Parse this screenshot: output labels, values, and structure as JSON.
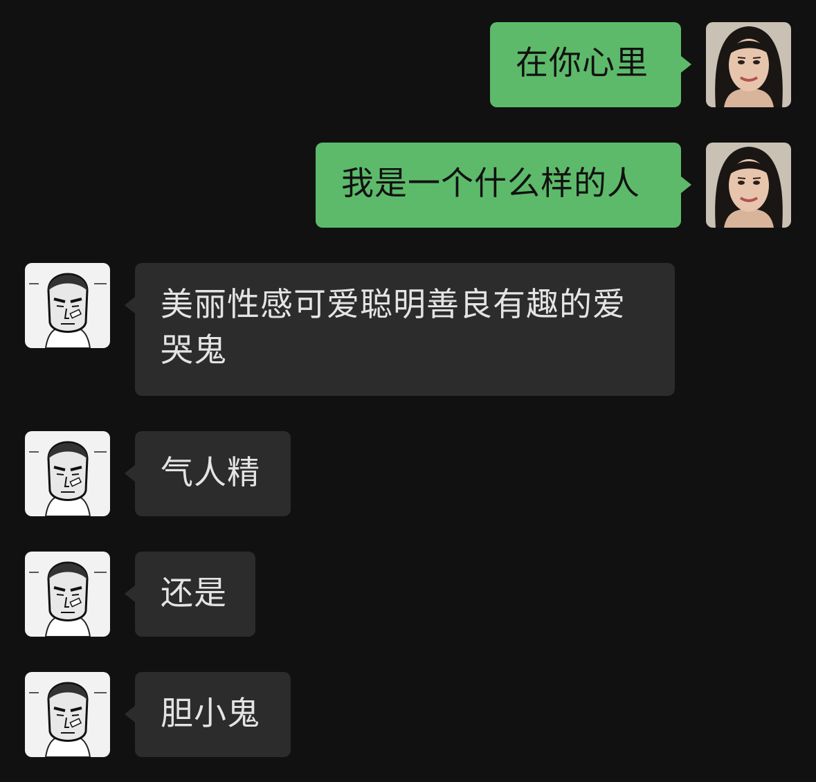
{
  "colors": {
    "background": "#111111",
    "sent_bubble": "#5dba6a",
    "received_bubble": "#2c2c2c",
    "received_text": "#e4e4e4",
    "sent_text": "#111111"
  },
  "messages": [
    {
      "sender": "me",
      "text": "在你心里"
    },
    {
      "sender": "me",
      "text": "我是一个什么样的人"
    },
    {
      "sender": "contact",
      "text": "美丽性感可爱聪明善良有趣的爱哭鬼"
    },
    {
      "sender": "contact",
      "text": "气人精"
    },
    {
      "sender": "contact",
      "text": "还是"
    },
    {
      "sender": "contact",
      "text": "胆小鬼"
    }
  ]
}
